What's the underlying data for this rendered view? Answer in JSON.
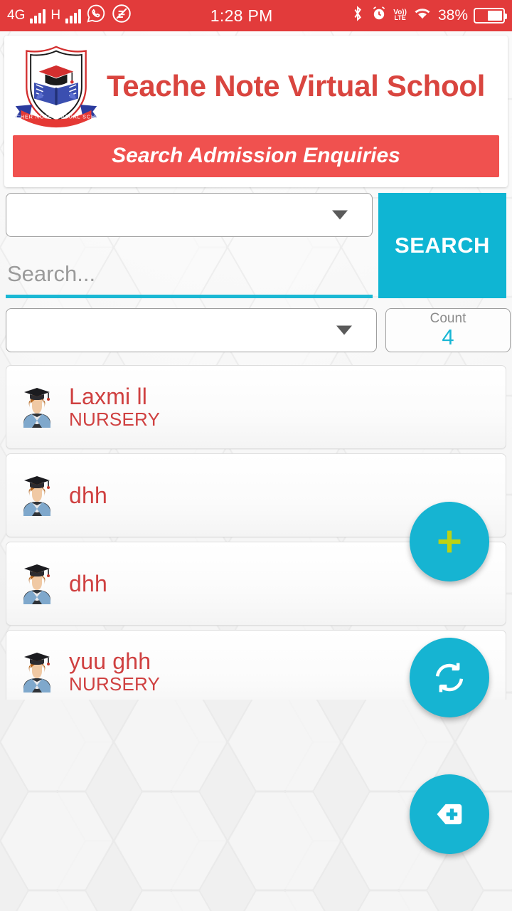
{
  "status_bar": {
    "network_4g": "4G",
    "network_h": "H",
    "whatsapp_icon": "whatsapp-icon",
    "app_icon": "app-icon",
    "time": "1:28 PM",
    "bluetooth_icon": "bluetooth-icon",
    "alarm_icon": "alarm-icon",
    "volte_top": "Vo))",
    "volte_bottom": "LTE",
    "wifi_icon": "wifi-icon",
    "battery_percent": "38%",
    "background_color": "#e23b3b"
  },
  "header": {
    "logo_name": "school-crest-logo",
    "logo_ribbon_text": "TEACHER NOTE VIRTUAL SCHOOL",
    "title": "Teache Note Virtual School",
    "title_color": "#d9453f",
    "banner_text": "Search Admission Enquiries",
    "banner_color": "#f0514f"
  },
  "filters": {
    "class_select": {
      "value": "",
      "placeholder": ""
    },
    "search": {
      "value": "",
      "placeholder": "Search..."
    },
    "search_button_label": "SEARCH",
    "status_select": {
      "value": "",
      "placeholder": ""
    },
    "count_label": "Count",
    "count_value": "4",
    "accent_color": "#0fb5d3"
  },
  "students": [
    {
      "avatar": "graduate-avatar-icon",
      "name": "Laxmi  ll",
      "class": "NURSERY"
    },
    {
      "avatar": "graduate-avatar-icon",
      "name": "dhh",
      "class": ""
    },
    {
      "avatar": "graduate-avatar-icon",
      "name": "dhh",
      "class": ""
    },
    {
      "avatar": "graduate-avatar-icon",
      "name": "yuu ghh",
      "class": "NURSERY"
    }
  ],
  "fabs": [
    {
      "name": "add-enquiry-fab",
      "icon": "plus-icon",
      "icon_color": "#b6cf11",
      "bg_color": "#16b4d2"
    },
    {
      "name": "refresh-fab",
      "icon": "refresh-icon",
      "icon_color": "#ffffff",
      "bg_color": "#16b4d2"
    },
    {
      "name": "add-tag-fab",
      "icon": "add-tag-icon",
      "icon_color": "#ffffff",
      "bg_color": "#16b4d2"
    }
  ]
}
